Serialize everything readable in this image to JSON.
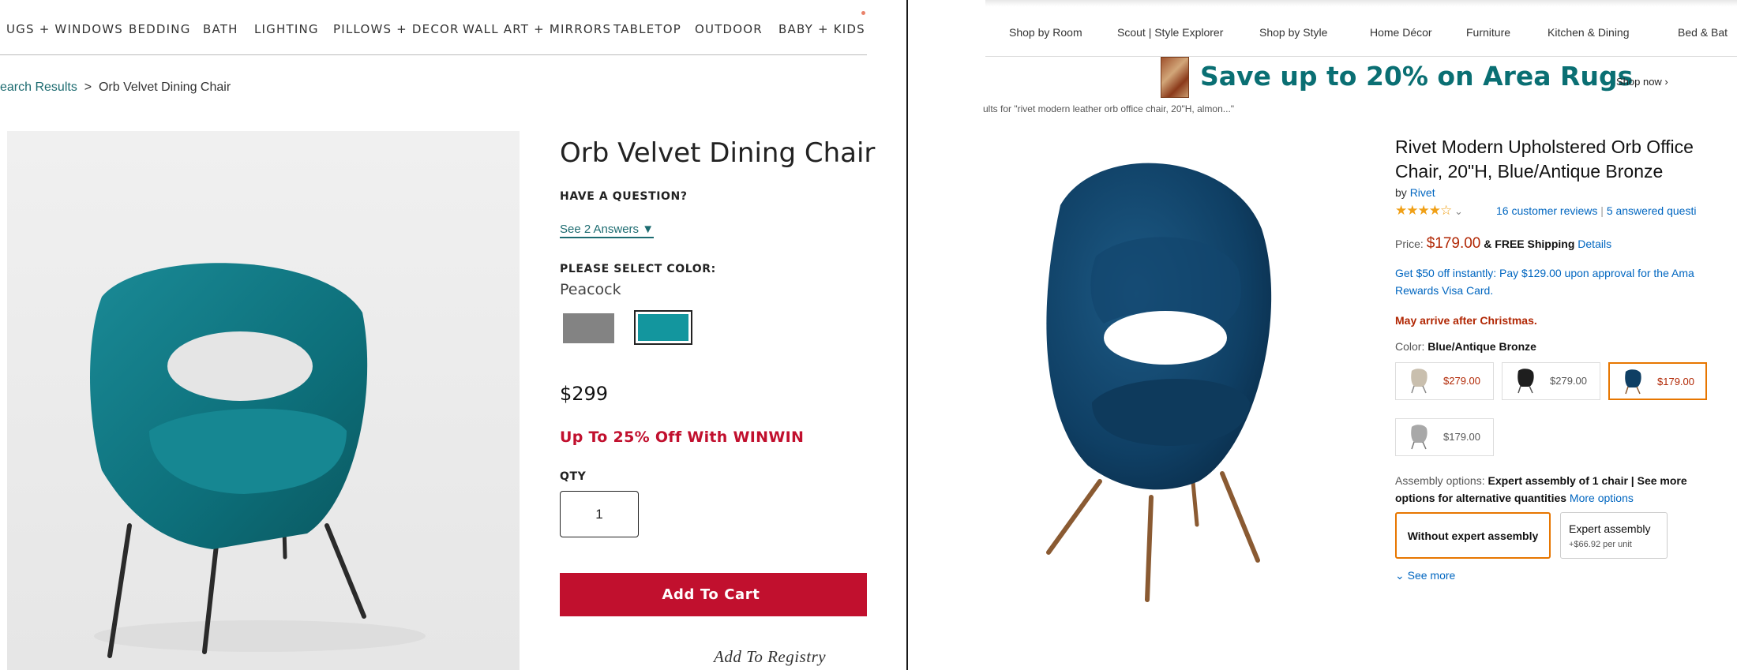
{
  "left": {
    "nav": [
      "UGS + WINDOWS",
      "BEDDING",
      "BATH",
      "LIGHTING",
      "PILLOWS + DECOR",
      "WALL ART + MIRRORS",
      "TABLETOP",
      "OUTDOOR",
      "BABY + KIDS"
    ],
    "breadcrumb": {
      "first": "earch Results",
      "separator": ">",
      "current": "Orb Velvet Dining Chair"
    },
    "product_title": "Orb Velvet Dining Chair",
    "question_label": "HAVE A QUESTION?",
    "answers_link": "See 2 Answers ▼",
    "color_label": "PLEASE SELECT COLOR:",
    "color_value": "Peacock",
    "price": "$299",
    "promo": "Up To 25% Off With WINWIN",
    "qty_label": "QTY",
    "qty_value": "1",
    "add_to_cart": "Add To Cart",
    "add_to_registry": "Add To Registry",
    "colors": {
      "brand_red": "#c1102e",
      "link_teal": "#1c6b70",
      "peacock": "#13969e",
      "gray_swatch": "#838383"
    }
  },
  "right": {
    "nav": [
      "Shop by Room",
      "Scout | Style Explorer",
      "Shop by Style",
      "Home Décor",
      "Furniture",
      "Kitchen & Dining",
      "Bed & Bat"
    ],
    "banner": {
      "text": "Save up to 20% on Area Rugs",
      "cta": "Shop now ›"
    },
    "results_text": "ults for \"rivet modern leather orb office chair, 20\"H, almon...\"",
    "title": "Rivet Modern Upholstered Orb Office Chair, 20\"H, Blue/Antique Bronze",
    "by_prefix": "by",
    "brand": "Rivet",
    "stars": "★★★★☆",
    "rating_chevron": "⌄",
    "reviews": "16 customer reviews",
    "review_sep": "|",
    "answered": "5 answered questi",
    "price_label": "Price:",
    "price": "$179.00",
    "shipping_prefix": "&",
    "shipping": "FREE Shipping",
    "details_link": "Details",
    "visa_offer": "Get $50 off instantly: Pay $129.00 upon approval for the Ama Rewards Visa Card.",
    "christmas": "May arrive after Christmas.",
    "color_label": "Color:",
    "color_value": "Blue/Antique Bronze",
    "options": [
      {
        "price": "$279.00",
        "swatch": "beige"
      },
      {
        "price": "$279.00",
        "swatch": "black"
      },
      {
        "price": "$179.00",
        "swatch": "blue"
      },
      {
        "price": "$179.00",
        "swatch": "gray"
      }
    ],
    "assembly_label": "Assembly options:",
    "assembly_bold": "Expert assembly of 1 chair | See more options for alternative quantities",
    "more_options": "More options",
    "btn_without": "Without expert assembly",
    "btn_expert_title": "Expert assembly",
    "btn_expert_price": "+$66.92",
    "btn_expert_unit": "per unit",
    "see_more": "⌄ See more",
    "colors": {
      "link_blue": "#0066c0",
      "price_red": "#b12704",
      "banner_teal": "#0a6f73",
      "selected_orange": "#e77600",
      "chair_blue": "#0f3f64"
    }
  }
}
